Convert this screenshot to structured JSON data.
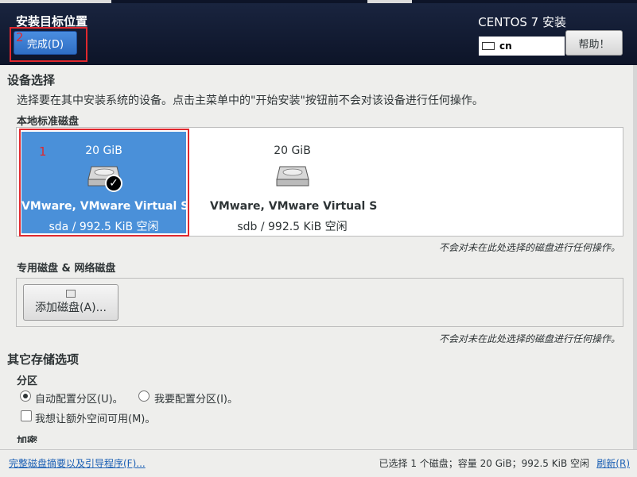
{
  "header": {
    "title": "安装目标位置",
    "done_button": "完成(D)",
    "product": "CENTOS 7 安装",
    "keyboard_layout": "cn",
    "help_button": "帮助！",
    "annotation_done": "2",
    "annotation_disk": "1"
  },
  "device_selection": {
    "title": "设备选择",
    "description": "选择要在其中安装系统的设备。点击主菜单中的\"开始安装\"按钮前不会对该设备进行任何操作。",
    "local_disks_label": "本地标准磁盘",
    "disks": [
      {
        "size": "20 GiB",
        "name": "VMware, VMware Virtual S",
        "info": "sda   /   992.5 KiB 空闲",
        "selected": true
      },
      {
        "size": "20 GiB",
        "name": "VMware, VMware Virtual S",
        "info": "sdb   /   992.5 KiB 空闲",
        "selected": false
      }
    ],
    "local_note": "不会对未在此处选择的磁盘进行任何操作。",
    "specialized_label": "专用磁盘 & 网络磁盘",
    "add_disk_button": "添加磁盘(A)...",
    "specialized_note": "不会对未在此处选择的磁盘进行任何操作。"
  },
  "other_storage": {
    "title": "其它存储选项",
    "partition_label": "分区",
    "auto_partition": "自动配置分区(U)。",
    "manual_partition": "我要配置分区(I)。",
    "extra_space": "我想让额外空间可用(M)。",
    "encryption_label": "加密"
  },
  "footer": {
    "summary_link": "完整磁盘摘要以及引导程序(F)...",
    "status": "已选择 1 个磁盘；容量 20 GiB；992.5 KiB 空闲",
    "refresh_link": "刷新(R)"
  },
  "colors": {
    "header_bg": "#0d1428",
    "selected_disk": "#4a90d9",
    "done_button": "#3a7bd5",
    "annotation_red": "#e0282e"
  }
}
